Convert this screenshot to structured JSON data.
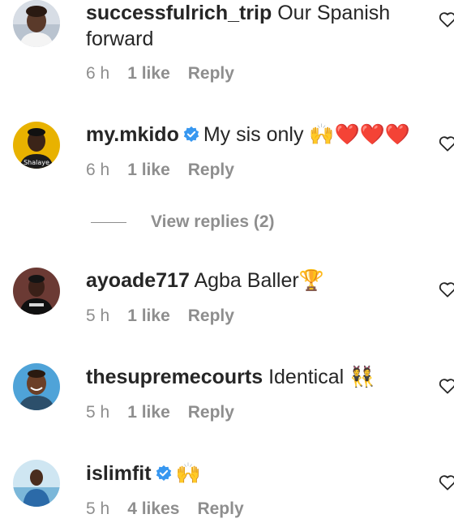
{
  "comments": [
    {
      "username": "successfulrich_trip",
      "verified": false,
      "text": "Our Spanish forward",
      "time": "6 h",
      "likes": "1 like",
      "reply": "Reply"
    },
    {
      "username": "my.mkido",
      "verified": true,
      "text": "My sis only 🙌❤️❤️❤️",
      "time": "6 h",
      "likes": "1 like",
      "reply": "Reply",
      "view_replies": "View replies (2)"
    },
    {
      "username": "ayoade717",
      "verified": false,
      "text": "Agba Baller🏆",
      "time": "5 h",
      "likes": "1 like",
      "reply": "Reply"
    },
    {
      "username": "thesupremecourts",
      "verified": false,
      "text": "Identical 👯",
      "time": "5 h",
      "likes": "1 like",
      "reply": "Reply"
    },
    {
      "username": "islimfit",
      "verified": true,
      "text": "🙌",
      "time": "5 h",
      "likes": "4 likes",
      "reply": "Reply"
    }
  ],
  "icons": {
    "like": "heart-outline-icon",
    "verified": "verified-badge-icon"
  },
  "colors": {
    "text": "#262626",
    "muted": "#8e8e8e",
    "verified_blue": "#3797f0"
  }
}
